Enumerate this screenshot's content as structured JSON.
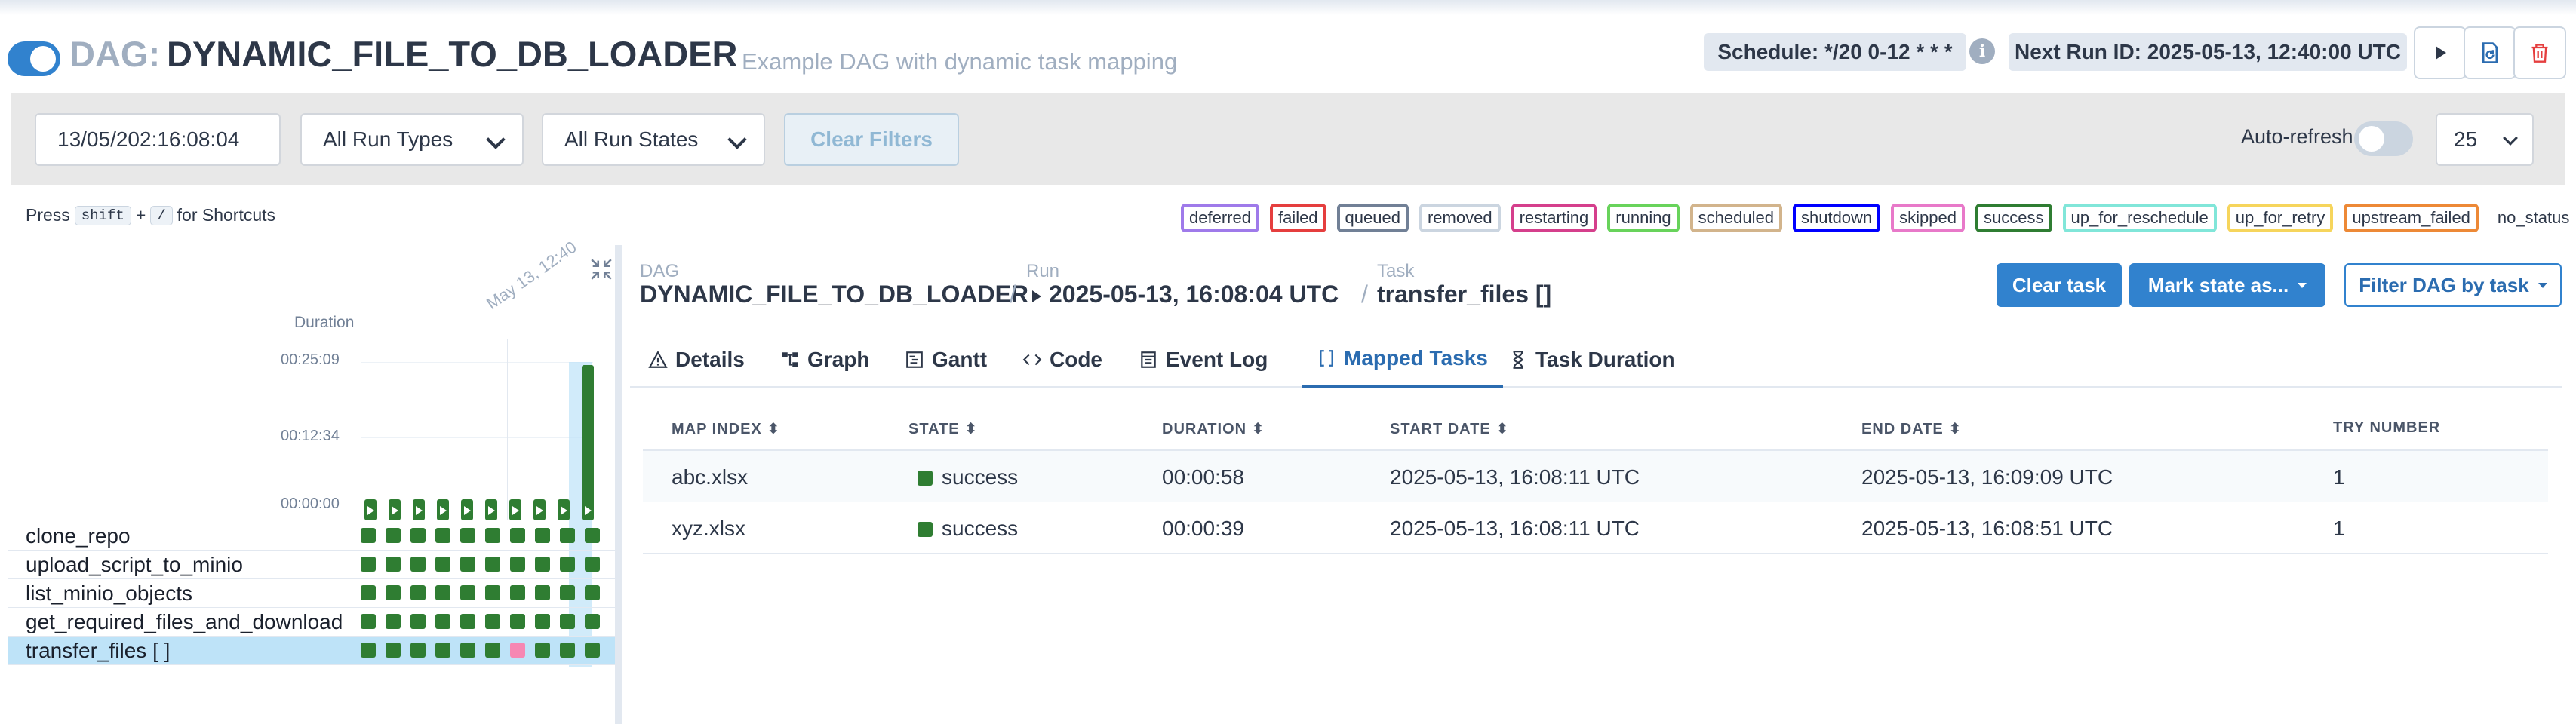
{
  "header": {
    "dag_prefix": "DAG:",
    "dag_id": "DYNAMIC_FILE_TO_DB_LOADER",
    "description": "Example DAG with dynamic task mapping",
    "schedule": "Schedule: */20 0-12 * * *",
    "next_run": "Next Run ID: 2025-05-13, 12:40:00 UTC",
    "actions": [
      "play-icon",
      "reparse-icon",
      "trash-icon"
    ],
    "colors": {
      "accent": "#3182ce",
      "delete": "#e53e3e"
    }
  },
  "filters": {
    "date_value": "13/05/202:16:08:04",
    "run_types": "All Run Types",
    "run_states": "All Run States",
    "clear_label": "Clear Filters",
    "auto_refresh_label": "Auto-refresh",
    "page_size": "25"
  },
  "shortcuts": {
    "press": "Press",
    "key1": "shift",
    "plus": "+",
    "key2": "/",
    "suffix": "for Shortcuts"
  },
  "legend": [
    {
      "label": "deferred",
      "color": "#9f7aea"
    },
    {
      "label": "failed",
      "color": "#e53e3e"
    },
    {
      "label": "queued",
      "color": "#718096"
    },
    {
      "label": "removed",
      "color": "#cbd5e0"
    },
    {
      "label": "restarting",
      "color": "#d53f8c"
    },
    {
      "label": "running",
      "color": "#68d35b"
    },
    {
      "label": "scheduled",
      "color": "#d2b48c"
    },
    {
      "label": "shutdown",
      "color": "#0000ff"
    },
    {
      "label": "skipped",
      "color": "#e879c9"
    },
    {
      "label": "success",
      "color": "#2f7d32"
    },
    {
      "label": "up_for_reschedule",
      "color": "#81e6d9"
    },
    {
      "label": "up_for_retry",
      "color": "#f6d55c"
    },
    {
      "label": "upstream_failed",
      "color": "#ed8936"
    },
    {
      "label": "no_status",
      "color": ""
    }
  ],
  "grid": {
    "duration_label": "Duration",
    "yticks": [
      "00:25:09",
      "00:12:34",
      "00:00:00"
    ],
    "run_date_label": "May 13, 12:40",
    "runs_duration_fraction": [
      0.06,
      0.06,
      0.06,
      0.06,
      0.06,
      0.06,
      0.06,
      0.06,
      0.06,
      1.0
    ],
    "tasks": [
      {
        "name": "clone_repo",
        "states": [
          "success",
          "success",
          "success",
          "success",
          "success",
          "success",
          "success",
          "success",
          "success",
          "success"
        ]
      },
      {
        "name": "upload_script_to_minio",
        "states": [
          "success",
          "success",
          "success",
          "success",
          "success",
          "success",
          "success",
          "success",
          "success",
          "success"
        ]
      },
      {
        "name": "list_minio_objects",
        "states": [
          "success",
          "success",
          "success",
          "success",
          "success",
          "success",
          "success",
          "success",
          "success",
          "success"
        ]
      },
      {
        "name": "get_required_files_and_download",
        "states": [
          "success",
          "success",
          "success",
          "success",
          "success",
          "success",
          "success",
          "success",
          "success",
          "success"
        ]
      },
      {
        "name": "transfer_files [ ]",
        "states": [
          "success",
          "success",
          "success",
          "success",
          "success",
          "success",
          "skipped",
          "success",
          "success",
          "success"
        ],
        "selected": true
      }
    ]
  },
  "breadcrumb": {
    "dag_label": "DAG",
    "dag_value": "DYNAMIC_FILE_TO_DB_LOADER",
    "run_label": "Run",
    "run_value": "2025-05-13, 16:08:04 UTC",
    "task_label": "Task",
    "task_value": "transfer_files []",
    "sep": "/"
  },
  "actions": {
    "clear_task": "Clear task",
    "mark_state": "Mark state as...",
    "filter_dag": "Filter DAG by task"
  },
  "tabs": [
    {
      "label": "Details",
      "icon": "warning-icon"
    },
    {
      "label": "Graph",
      "icon": "graph-icon"
    },
    {
      "label": "Gantt",
      "icon": "gantt-icon"
    },
    {
      "label": "Code",
      "icon": "code-icon"
    },
    {
      "label": "Event Log",
      "icon": "event-log-icon"
    },
    {
      "label": "Mapped Tasks",
      "icon": "brackets-icon",
      "active": true
    },
    {
      "label": "Task Duration",
      "icon": "hourglass-icon"
    }
  ],
  "table": {
    "columns": [
      "MAP INDEX",
      "STATE",
      "DURATION",
      "START DATE",
      "END DATE",
      "TRY NUMBER"
    ],
    "rows": [
      [
        "abc.xlsx",
        "success",
        "00:00:58",
        "2025-05-13, 16:08:11 UTC",
        "2025-05-13, 16:09:09 UTC",
        "1"
      ],
      [
        "xyz.xlsx",
        "success",
        "00:00:39",
        "2025-05-13, 16:08:11 UTC",
        "2025-05-13, 16:08:51 UTC",
        "1"
      ]
    ]
  }
}
